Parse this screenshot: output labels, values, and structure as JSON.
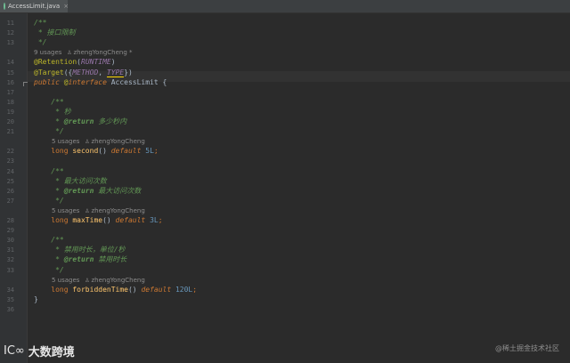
{
  "editor": {
    "tab": {
      "filename": "AccessLimit.java",
      "close": "×"
    },
    "lines": [
      {
        "num": "11",
        "tokens": [
          {
            "c": "c-doc",
            "t": "/**"
          }
        ]
      },
      {
        "num": "12",
        "tokens": [
          {
            "c": "c-doc",
            "t": " * 接口限制"
          }
        ]
      },
      {
        "num": "13",
        "tokens": [
          {
            "c": "c-doc",
            "t": " */"
          }
        ]
      },
      {
        "inlay": {
          "usages": "9 usages",
          "author": "zhengYongCheng *"
        },
        "indent": 0
      },
      {
        "num": "14",
        "tokens": [
          {
            "c": "c-ann",
            "t": "@Retention"
          },
          {
            "c": "c-text",
            "t": "("
          },
          {
            "c": "c-const",
            "t": "RUNTIME"
          },
          {
            "c": "c-text",
            "t": ")"
          }
        ]
      },
      {
        "num": "15",
        "tokens": [
          {
            "c": "c-ann",
            "t": "@Target"
          },
          {
            "c": "c-text",
            "t": "({"
          },
          {
            "c": "c-const",
            "t": "METHOD"
          },
          {
            "c": "c-text",
            "t": ", "
          },
          {
            "c": "c-const underline-yellow",
            "t": "TYPE"
          },
          {
            "c": "c-text",
            "t": "})"
          }
        ]
      },
      {
        "num": "16",
        "tokens": [
          {
            "c": "c-kwi",
            "t": "public "
          },
          {
            "c": "c-ann",
            "t": "@"
          },
          {
            "c": "c-kwi",
            "t": "interface "
          },
          {
            "c": "c-text",
            "t": "AccessLimit {"
          }
        ]
      },
      {
        "num": "17",
        "tokens": []
      },
      {
        "num": "18",
        "tokens": [
          {
            "c": "c-doc",
            "t": "    /**"
          }
        ]
      },
      {
        "num": "19",
        "tokens": [
          {
            "c": "c-doc",
            "t": "     * 秒"
          }
        ]
      },
      {
        "num": "20",
        "tokens": [
          {
            "c": "c-doc",
            "t": "     * "
          },
          {
            "c": "c-doctag",
            "t": "@return"
          },
          {
            "c": "c-doc",
            "t": " 多少秒内"
          }
        ]
      },
      {
        "num": "21",
        "tokens": [
          {
            "c": "c-doc",
            "t": "     */"
          }
        ]
      },
      {
        "inlay": {
          "usages": "5 usages",
          "author": "zhengYongCheng"
        },
        "indent": 1
      },
      {
        "num": "22",
        "tokens": [
          {
            "c": "c-kw",
            "t": "    long "
          },
          {
            "c": "c-fn",
            "t": "second"
          },
          {
            "c": "c-text",
            "t": "() "
          },
          {
            "c": "c-kwi",
            "t": "default "
          },
          {
            "c": "c-num",
            "t": "5L"
          },
          {
            "c": "c-kw",
            "t": ";"
          }
        ]
      },
      {
        "num": "23",
        "tokens": []
      },
      {
        "num": "24",
        "tokens": [
          {
            "c": "c-doc",
            "t": "    /**"
          }
        ]
      },
      {
        "num": "25",
        "tokens": [
          {
            "c": "c-doc",
            "t": "     * 最大访问次数"
          }
        ]
      },
      {
        "num": "26",
        "tokens": [
          {
            "c": "c-doc",
            "t": "     * "
          },
          {
            "c": "c-doctag",
            "t": "@return"
          },
          {
            "c": "c-doc",
            "t": " 最大访问次数"
          }
        ]
      },
      {
        "num": "27",
        "tokens": [
          {
            "c": "c-doc",
            "t": "     */"
          }
        ]
      },
      {
        "inlay": {
          "usages": "5 usages",
          "author": "zhengYongCheng"
        },
        "indent": 1
      },
      {
        "num": "28",
        "tokens": [
          {
            "c": "c-kw",
            "t": "    long "
          },
          {
            "c": "c-fn",
            "t": "maxTime"
          },
          {
            "c": "c-text",
            "t": "() "
          },
          {
            "c": "c-kwi",
            "t": "default "
          },
          {
            "c": "c-num",
            "t": "3L"
          },
          {
            "c": "c-kw",
            "t": ";"
          }
        ]
      },
      {
        "num": "29",
        "tokens": []
      },
      {
        "num": "30",
        "tokens": [
          {
            "c": "c-doc",
            "t": "    /**"
          }
        ]
      },
      {
        "num": "31",
        "tokens": [
          {
            "c": "c-doc",
            "t": "     * 禁用时长，单位/秒"
          }
        ]
      },
      {
        "num": "32",
        "tokens": [
          {
            "c": "c-doc",
            "t": "     * "
          },
          {
            "c": "c-doctag",
            "t": "@return"
          },
          {
            "c": "c-doc",
            "t": " 禁用时长"
          }
        ]
      },
      {
        "num": "33",
        "tokens": [
          {
            "c": "c-doc",
            "t": "     */"
          }
        ]
      },
      {
        "inlay": {
          "usages": "5 usages",
          "author": "zhengYongCheng"
        },
        "indent": 1
      },
      {
        "num": "34",
        "tokens": [
          {
            "c": "c-kw",
            "t": "    long "
          },
          {
            "c": "c-fn",
            "t": "forbiddenTime"
          },
          {
            "c": "c-text",
            "t": "() "
          },
          {
            "c": "c-kwi",
            "t": "default "
          },
          {
            "c": "c-num",
            "t": "120L"
          },
          {
            "c": "c-kw",
            "t": ";"
          }
        ]
      },
      {
        "num": "35",
        "tokens": [
          {
            "c": "c-text",
            "t": "}"
          }
        ]
      },
      {
        "num": "36",
        "tokens": []
      }
    ]
  },
  "watermarks": {
    "left_logo": "IC∞",
    "left_text": "大数跨境",
    "right_text": "@稀土掘金技术社区"
  },
  "icons": {
    "tab_icon": "java-class-icon",
    "author_icon": "person-icon"
  },
  "colors": {
    "background": "#2b2b2b",
    "keyword": "#cc7832",
    "doc": "#629755",
    "annotation": "#bbb529",
    "function": "#ffc66d",
    "number": "#6897bb"
  }
}
